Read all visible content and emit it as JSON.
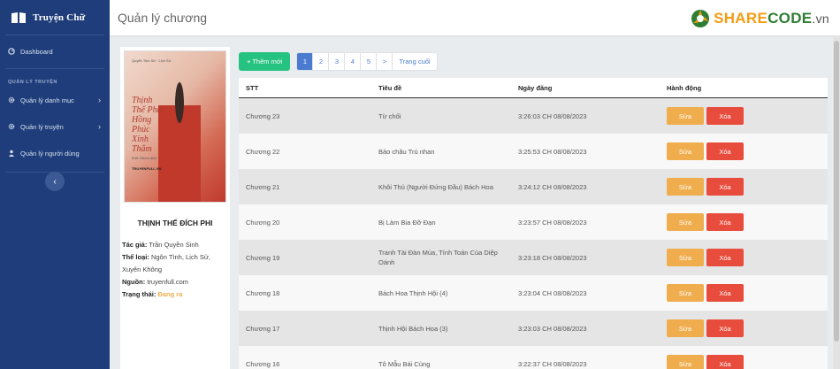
{
  "sidebar": {
    "brand": "Truyện Chữ",
    "dashboard": "Dashboard",
    "section": "QUẢN LÝ TRUYỆN",
    "items": [
      {
        "label": "Quản lý danh mục"
      },
      {
        "label": "Quản lý truyện"
      },
      {
        "label": "Quản lý người dùng"
      }
    ]
  },
  "header": {
    "title": "Quản lý chương",
    "logo_share": "SHARE",
    "logo_code": "CODE",
    "logo_vn": ".vn"
  },
  "book": {
    "cover_text": "Thịnh Thế Phúc Hồng Phúc Xinh Thắm",
    "title": "THỊNH THẾ ĐÍCH PHI",
    "author_label": "Tác giả:",
    "author": "Trần Quyền Sinh",
    "genre_label": "Thể loại:",
    "genre": "Ngôn Tình, Lịch Sử, Xuyên Không",
    "source_label": "Nguồn:",
    "source": "truyenfull.com",
    "status_label": "Trạng thái:",
    "status": "Đang ra"
  },
  "toolbar": {
    "add_label": "+ Thêm mới",
    "pages": [
      "1",
      "2",
      "3",
      "4",
      "5",
      ">",
      "Trang cuối"
    ],
    "active_page": "1"
  },
  "table": {
    "headers": [
      "STT",
      "Tiêu đề",
      "Ngày đăng",
      "Hành động"
    ],
    "edit_label": "Sửa",
    "delete_label": "Xóa",
    "rows": [
      {
        "stt": "Chương 23",
        "title": "Từ chối",
        "date": "3:26:03 CH 08/08/2023"
      },
      {
        "stt": "Chương 22",
        "title": "Bảo châu Trú nhan",
        "date": "3:25:53 CH 08/08/2023"
      },
      {
        "stt": "Chương 21",
        "title": "Khôi Thủ (Người Đứng Đầu) Bách Hoa",
        "date": "3:24:12 CH 08/08/2023"
      },
      {
        "stt": "Chương 20",
        "title": "Bị Làm Bia Đỡ Đạn",
        "date": "3:23:57 CH 08/08/2023"
      },
      {
        "stt": "Chương 19",
        "title": "Tranh Tài Đàn Múa, Tính Toán Của Diệp Oánh",
        "date": "3:23:18 CH 08/08/2023"
      },
      {
        "stt": "Chương 18",
        "title": "Bách Hoa Thịnh Hội (4)",
        "date": "3:23:04 CH 08/08/2023"
      },
      {
        "stt": "Chương 17",
        "title": "Thịnh Hội Bách Hoa (3)",
        "date": "3:23:03 CH 08/08/2023"
      },
      {
        "stt": "Chương 16",
        "title": "Tô Mẫu Bái Cùng",
        "date": "3:22:37 CH 08/08/2023"
      }
    ]
  }
}
